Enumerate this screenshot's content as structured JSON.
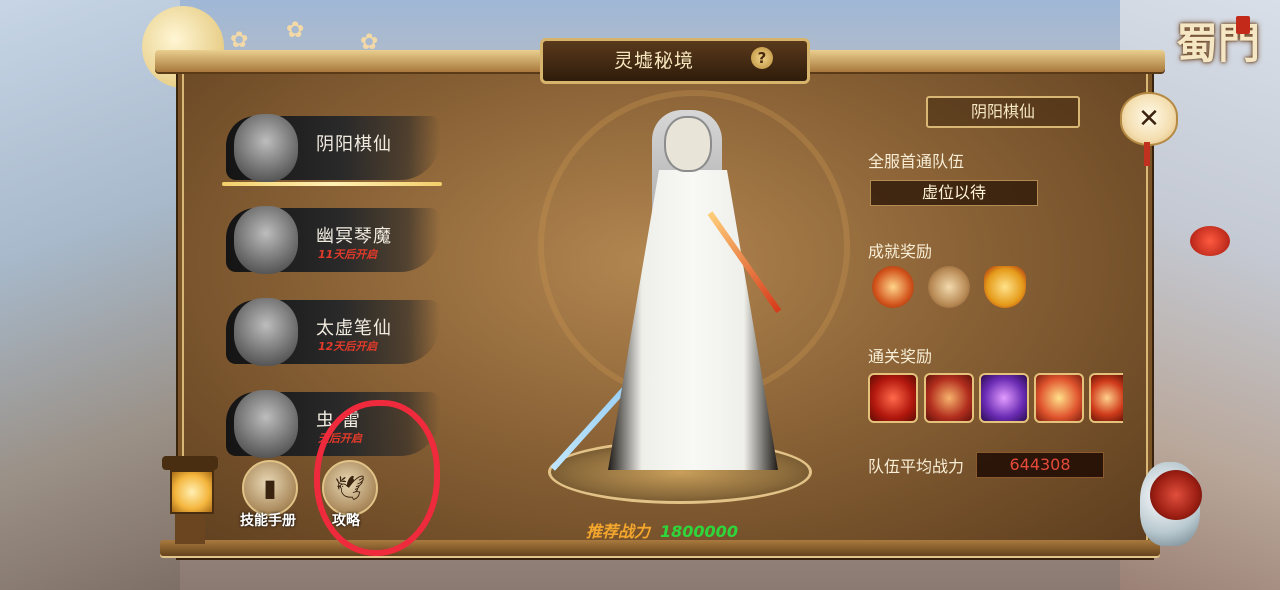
{
  "game": {
    "logo_text": "蜀門"
  },
  "header": {
    "title": "灵墟秘境",
    "help_symbol": "?"
  },
  "close_symbol": "✕",
  "boss_list": [
    {
      "name": "阴阳棋仙",
      "status": "",
      "selected": true
    },
    {
      "name": "幽冥琴魔",
      "status": "11天后开启",
      "selected": false
    },
    {
      "name": "太虚笔仙",
      "status": "12天后开启",
      "selected": false
    },
    {
      "name": "虫  雷",
      "status": "天后开启",
      "selected": false
    }
  ],
  "bottom_buttons": {
    "skill_manual": "技能手册",
    "guide": "攻略"
  },
  "recommended": {
    "label": "推荐战力",
    "value": "1800000"
  },
  "detail": {
    "boss_name": "阴阳棋仙",
    "first_clear_label": "全服首通队伍",
    "first_clear_value": "虚位以待",
    "achievement_label": "成就奖励",
    "clear_reward_label": "通关奖励",
    "avg_power_label": "队伍平均战力",
    "avg_power_value": "644308"
  },
  "colors": {
    "accent_gold": "#d9b877",
    "highlight_red": "#ee2a3c",
    "power_green": "#2fd63b",
    "power_orange": "#f4a62d"
  }
}
